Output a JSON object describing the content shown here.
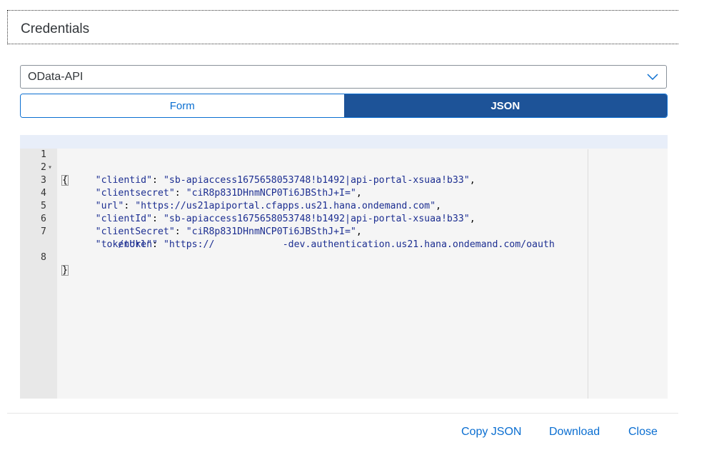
{
  "header": {
    "title": "Credentials"
  },
  "select": {
    "value": "OData-API",
    "icon": "chevron-down-icon"
  },
  "tabs": [
    {
      "label": "Form",
      "selected": false
    },
    {
      "label": "JSON",
      "selected": true
    }
  ],
  "editor": {
    "lines": [
      {
        "num": "1",
        "text": "{"
      },
      {
        "num": "2",
        "key": "\"clientid\"",
        "value": "\"sb-apiaccess1675658053748!b1492|api-portal-xsuaa!b33\""
      },
      {
        "num": "3",
        "key": "\"clientsecret\"",
        "value": "\"ciR8p831DHnmNCP0Ti6JBSthJ+I=\""
      },
      {
        "num": "4",
        "key": "\"url\"",
        "value": "\"https://us21apiportal.cfapps.us21.hana.ondemand.com\""
      },
      {
        "num": "5",
        "key": "\"clientId\"",
        "value": "\"sb-apiaccess1675658053748!b1492|api-portal-xsuaa!b33\""
      },
      {
        "num": "6",
        "key": "\"clientSecret\"",
        "value": "\"ciR8p831DHnmNCP0Ti6JBSthJ+I=\""
      },
      {
        "num": "7",
        "key": "\"tokenUrl\"",
        "value_part1": "\"https://",
        "value_part2": "-dev.authentication.us21.hana.ondemand.com/oauth",
        "value_cont": "/token\""
      },
      {
        "num": "8",
        "text": "}"
      }
    ]
  },
  "footer": {
    "copy_label": "Copy JSON",
    "download_label": "Download",
    "close_label": "Close"
  },
  "colors": {
    "accent": "#0a6ed1",
    "selected_tab": "#1d5398"
  }
}
